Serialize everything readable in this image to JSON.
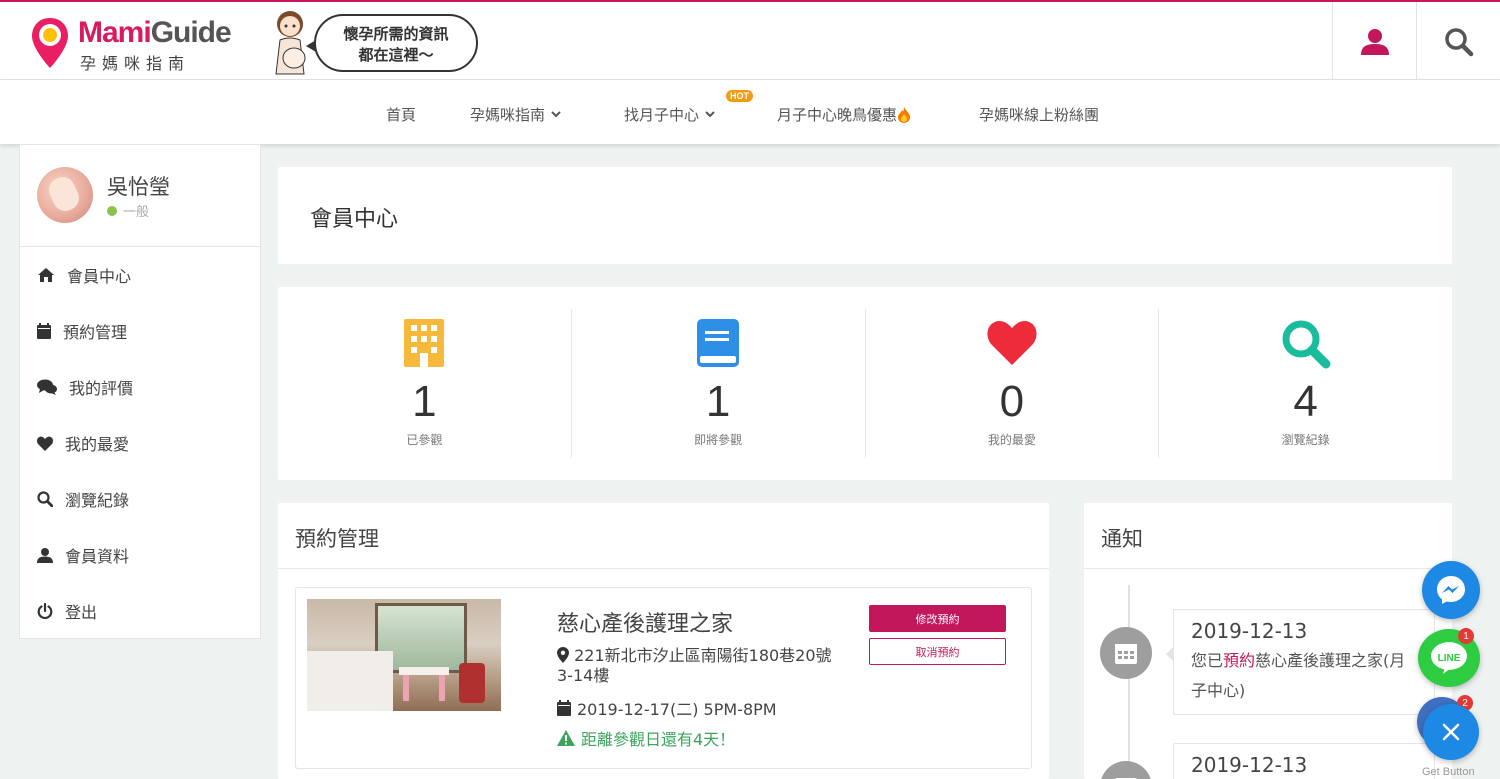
{
  "header": {
    "logo_brand_part1": "Mami",
    "logo_brand_part2": "Guide",
    "logo_subtitle": "孕媽咪指南",
    "bubble_line1": "懷孕所需的資訊",
    "bubble_line2": "都在這裡～"
  },
  "nav": {
    "items": [
      {
        "label": "首頁"
      },
      {
        "label": "孕媽咪指南"
      },
      {
        "label": "找月子中心"
      },
      {
        "label": "月子中心晚鳥優惠"
      },
      {
        "label": "孕媽咪線上粉絲團"
      }
    ],
    "hot_badge": "HOT"
  },
  "sidebar": {
    "user_name": "吳怡瑩",
    "user_level": "一般",
    "items": [
      {
        "label": "會員中心",
        "icon": "home-icon"
      },
      {
        "label": "預約管理",
        "icon": "calendar-icon"
      },
      {
        "label": "我的評價",
        "icon": "comments-icon"
      },
      {
        "label": "我的最愛",
        "icon": "heart-icon"
      },
      {
        "label": "瀏覽紀錄",
        "icon": "search-icon"
      },
      {
        "label": "會員資料",
        "icon": "user-icon"
      },
      {
        "label": "登出",
        "icon": "power-icon"
      }
    ]
  },
  "main": {
    "page_title": "會員中心",
    "stats": [
      {
        "value": "1",
        "label": "已參觀",
        "icon": "building-icon",
        "color": "#f6b93b"
      },
      {
        "value": "1",
        "label": "即將參觀",
        "icon": "book-icon",
        "color": "#2d8fe6"
      },
      {
        "value": "0",
        "label": "我的最愛",
        "icon": "heart-icon",
        "color": "#ee2b3a"
      },
      {
        "value": "4",
        "label": "瀏覽紀錄",
        "icon": "search-icon",
        "color": "#1abc9c"
      }
    ],
    "booking": {
      "title": "預約管理",
      "name": "慈心產後護理之家",
      "address": "221新北市汐止區南陽街180巷20號3-14樓",
      "date": "2019-12-17(二) 5PM-8PM",
      "countdown": "距離參觀日還有4天！",
      "edit_label": "修改預約",
      "cancel_label": "取消預約"
    },
    "notifications": {
      "title": "通知",
      "items": [
        {
          "date": "2019-12-13",
          "text_pre": "您已",
          "text_hl": "預約",
          "text_post": "慈心產後護理之家(月子中心)"
        },
        {
          "date": "2019-12-13"
        }
      ]
    }
  },
  "floating": {
    "line_label": "LINE",
    "line_badge": "1",
    "other_badge": "2",
    "get_button": "Get Button"
  },
  "colors": {
    "brand": "#c2185b",
    "success": "#3aa55b"
  }
}
